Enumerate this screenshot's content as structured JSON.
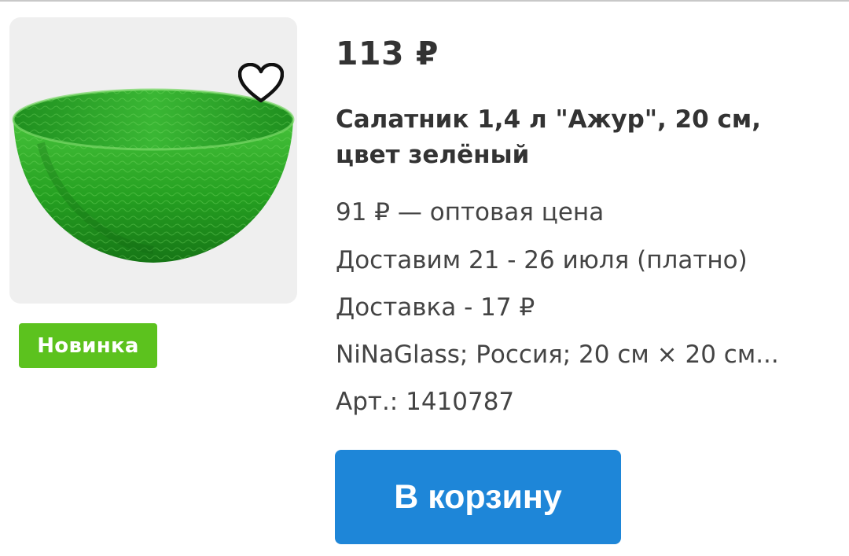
{
  "product": {
    "price": "113 ₽",
    "title": "Салатник 1,4 л \"Ажур\", 20 см, цвет зелёный",
    "badge": "Новинка",
    "wholesale_price": "91 ₽ — оптовая цена",
    "delivery_date": "Доставим 21 - 26 июля (платно)",
    "delivery_cost": "Доставка - 17 ₽",
    "specs": "NiNaGlass; Россия; 20 см × 20 см...",
    "article": "Арт.: 1410787"
  },
  "actions": {
    "cart_button_label": "В корзину"
  },
  "icons": {
    "favorite": "heart-outline-icon"
  },
  "colors": {
    "accent": "#1e86d8",
    "badge": "#5cc21e",
    "bowl": "#2a9a2a"
  }
}
